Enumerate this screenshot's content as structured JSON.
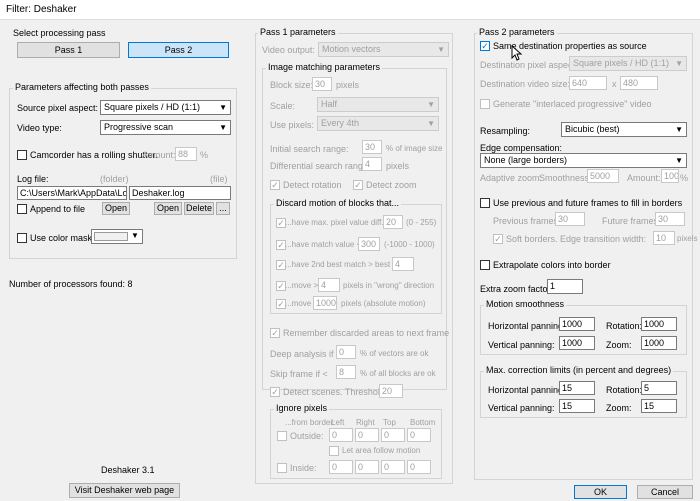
{
  "window": {
    "title": "Filter: Deshaker"
  },
  "pass_select": {
    "title": "Select processing pass",
    "pass1": "Pass 1",
    "pass2": "Pass 2"
  },
  "both_passes": {
    "title": "Parameters affecting both passes",
    "source_aspect_label": "Source pixel aspect:",
    "source_aspect_value": "Square pixels / HD  (1:1)",
    "video_type_label": "Video type:",
    "video_type_value": "Progressive scan",
    "camcorder_label": "Camcorder has a rolling shutter.",
    "amount_label": "Amount:",
    "amount_value": "88",
    "amount_unit": "%",
    "log_file_label": "Log file:",
    "folder_label": "(folder)",
    "file_label": "(file)",
    "folder_value": "C:\\Users\\Mark\\AppData\\Local",
    "file_value": "Deshaker.log",
    "append_label": "Append to file",
    "open1": "Open",
    "open2": "Open",
    "delete": "Delete",
    "ellipsis": "...",
    "color_mask_label": "Use color mask:"
  },
  "processors": "Number of processors found:  8",
  "footer": {
    "version": "Deshaker 3.1",
    "visit_button": "Visit Deshaker web page",
    "ok": "OK",
    "cancel": "Cancel"
  },
  "pass1": {
    "title": "Pass 1 parameters",
    "video_output_label": "Video output:",
    "video_output_value": "Motion vectors",
    "image_matching_title": "Image matching parameters",
    "block_size_label": "Block size:",
    "block_size_value": "30",
    "block_size_unit": "pixels",
    "scale_label": "Scale:",
    "scale_value": "Half",
    "use_pixels_label": "Use pixels:",
    "use_pixels_value": "Every 4th",
    "initial_search_label": "Initial search range:",
    "initial_search_value": "30",
    "initial_search_unit": "% of image size",
    "diff_search_label": "Differential search range:",
    "diff_search_value": "4",
    "diff_search_unit": "pixels",
    "detect_rotation": "Detect rotation",
    "detect_zoom": "Detect zoom",
    "discard_title": "Discard motion of blocks that...",
    "max_pixel_label": "...have max. pixel value diff. <",
    "max_pixel_value": "20",
    "max_pixel_range": "(0 - 255)",
    "match_label": "...have match value <",
    "match_value": "300",
    "match_range": "(-1000 - 1000)",
    "best_match_label": "...have 2nd best match > best -",
    "best_match_value": "4",
    "move_wrong_label": "...move >",
    "move_wrong_value": "4",
    "move_wrong_unit": "pixels in \"wrong\" direction",
    "move_abs_label": "...move >",
    "move_abs_value": "1000",
    "move_abs_unit": "pixels (absolute motion)",
    "remember": "Remember discarded areas to next frame",
    "deep_label": "Deep analysis if <",
    "deep_value": "0",
    "deep_unit": "% of vectors are ok",
    "skip_label": "Skip frame if <",
    "skip_value": "8",
    "skip_unit": "% of all blocks are ok",
    "detect_scenes": "Detect scenes. Threshold:",
    "threshold_value": "20",
    "ignore_title": "Ignore pixels",
    "from_border": "...from border:",
    "col_left": "Left",
    "col_right": "Right",
    "col_top": "Top",
    "col_bottom": "Bottom",
    "outside_label": "Outside:",
    "outside_values": [
      "0",
      "0",
      "0",
      "0"
    ],
    "let_area": "Let area follow motion",
    "inside_label": "Inside:",
    "inside_values": [
      "0",
      "0",
      "0",
      "0"
    ]
  },
  "pass2": {
    "title": "Pass 2 parameters",
    "same_dest": "Same destination properties as source",
    "dest_aspect_label": "Destination pixel aspect:",
    "dest_aspect_value": "Square pixels / HD  (1:1)",
    "dest_size_label": "Destination video size:",
    "dest_w": "640",
    "dest_x": "x",
    "dest_h": "480",
    "interlaced": "Generate \"interlaced progressive\" video",
    "resampling_label": "Resampling:",
    "resampling_value": "Bicubic  (best)",
    "edge_comp_label": "Edge compensation:",
    "edge_comp_value": "None  (large borders)",
    "adaptive_label": "Adaptive zoom:",
    "smoothness_label": "Smoothness:",
    "smoothness_value": "5000",
    "amount_label": "Amount:",
    "amount_value": "100",
    "amount_unit": "%",
    "use_prev_future": "Use previous and future frames to fill in borders",
    "prev_frames_label": "Previous frames:",
    "prev_frames_value": "30",
    "future_frames_label": "Future frames:",
    "future_frames_value": "30",
    "soft_borders": "Soft borders. Edge transition width:",
    "edge_width_value": "10",
    "edge_width_unit": "pixels",
    "extrapolate": "Extrapolate colors into border",
    "extra_zoom_label": "Extra zoom factor:",
    "extra_zoom_value": "1",
    "motion_smooth_title": "Motion smoothness",
    "h_pan_label": "Horizontal panning:",
    "h_pan_value": "1000",
    "rotation_label": "Rotation:",
    "rotation_value": "1000",
    "v_pan_label": "Vertical panning:",
    "v_pan_value": "1000",
    "zoom_label": "Zoom:",
    "zoom_value": "1000",
    "max_corr_title": "Max. correction limits (in percent and degrees)",
    "mc_h_pan_label": "Horizontal panning:",
    "mc_h_pan_value": "15",
    "mc_rotation_label": "Rotation:",
    "mc_rotation_value": "5",
    "mc_v_pan_label": "Vertical panning:",
    "mc_v_pan_value": "15",
    "mc_zoom_label": "Zoom:",
    "mc_zoom_value": "15"
  }
}
